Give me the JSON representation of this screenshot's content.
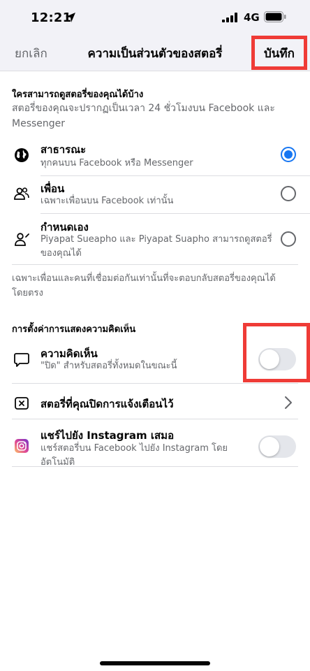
{
  "status_bar": {
    "time": "12:21",
    "network": "4G"
  },
  "nav": {
    "cancel_label": "ยกเลิก",
    "title": "ความเป็นส่วนตัวของสตอรี่",
    "save_label": "บันทึก"
  },
  "audience_section": {
    "heading": "ใครสามารถดูสตอรี่ของคุณได้บ้าง",
    "description": "สตอรี่ของคุณจะปรากฏเป็นเวลา 24 ชั่วโมงบน Facebook และ Messenger",
    "options": [
      {
        "icon": "globe-icon",
        "title": "สาธารณะ",
        "subtitle": "ทุกคนบน Facebook หรือ Messenger",
        "selected": true
      },
      {
        "icon": "friends-icon",
        "title": "เพื่อน",
        "subtitle": "เฉพาะเพื่อนบน Facebook เท่านั้น",
        "selected": false
      },
      {
        "icon": "custom-user-icon",
        "title": "กำหนดเอง",
        "subtitle": "Piyapat Sueapho และ Piyapat Suapho สามารถดูสตอรี่ของคุณได้",
        "selected": false
      }
    ],
    "footer_note": "เฉพาะเพื่อนและคนที่เชื่อมต่อกันเท่านั้นที่จะตอบกลับสตอรี่ของคุณได้โดยตรง"
  },
  "comment_section": {
    "heading": "การตั้งค่าการแสดงความคิดเห็น",
    "comments": {
      "icon": "comment-icon",
      "title": "ความคิดเห็น",
      "subtitle": "\"ปิด\" สำหรับสตอรี่ทั้งหมดในขณะนี้",
      "enabled": false
    },
    "muted_stories": {
      "icon": "muted-story-icon",
      "title": "สตอรี่ที่คุณปิดการแจ้งเตือนไว้"
    },
    "instagram_share": {
      "icon": "instagram-icon",
      "title": "แชร์ไปยัง Instagram เสมอ",
      "subtitle": "แชร์สตอรี่บน Facebook ไปยัง Instagram โดยอัตโนมัติ",
      "enabled": false
    }
  },
  "colors": {
    "accent": "#1877f2",
    "highlight": "#ef3b36",
    "secondary_text": "#65676b",
    "toggle_off": "#e4e6eb"
  }
}
